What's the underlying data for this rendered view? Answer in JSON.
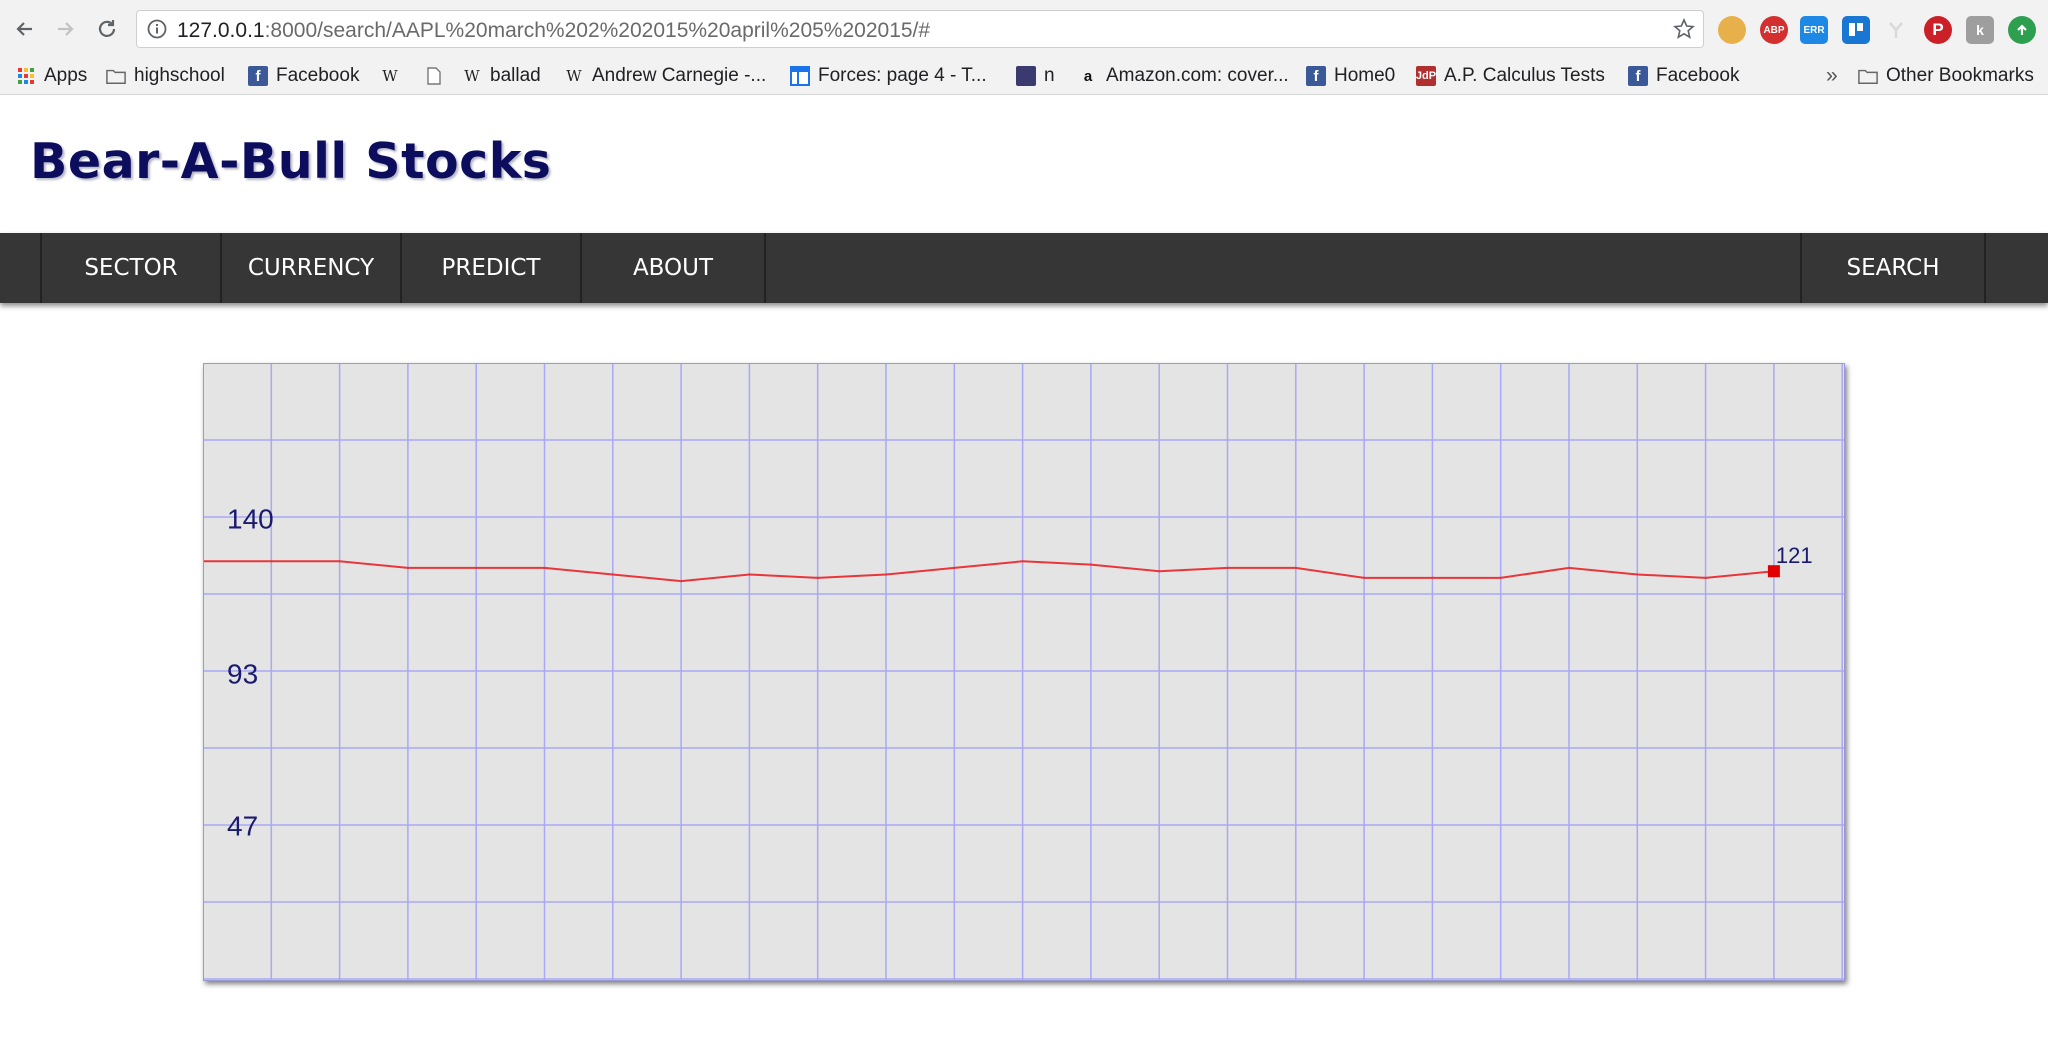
{
  "browser": {
    "url_host": "127.0.0.1",
    "url_rest": ":8000/search/AAPL%20march%202%202015%20april%205%202015/#",
    "bookmarks": [
      {
        "label": "Apps",
        "icon": "apps-grid-icon"
      },
      {
        "label": "highschool",
        "icon": "folder-icon"
      },
      {
        "label": "Facebook",
        "icon": "facebook-icon"
      },
      {
        "label": "",
        "icon": "wikipedia-icon"
      },
      {
        "label": "",
        "icon": "page-icon"
      },
      {
        "label": "ballad",
        "icon": "wikipedia-icon"
      },
      {
        "label": "Andrew Carnegie -...",
        "icon": "wikipedia-icon"
      },
      {
        "label": "Forces: page 4 - T...",
        "icon": "window-icon"
      },
      {
        "label": "n",
        "icon": "site-icon"
      },
      {
        "label": "Amazon.com: cover...",
        "icon": "amazon-icon"
      },
      {
        "label": "Home0",
        "icon": "facebook-icon"
      },
      {
        "label": "A.P. Calculus Tests",
        "icon": "site-icon"
      },
      {
        "label": "Facebook",
        "icon": "facebook-icon"
      }
    ],
    "overflow_label": "»",
    "other_bookmarks": "Other Bookmarks"
  },
  "site": {
    "title": "Bear-A-Bull Stocks"
  },
  "nav": {
    "items": [
      "SECTOR",
      "CURRENCY",
      "PREDICT",
      "ABOUT"
    ],
    "search": "SEARCH"
  },
  "chart_data": {
    "type": "line",
    "y_ticks": [
      "140",
      "93",
      "47"
    ],
    "ylim": [
      0,
      187
    ],
    "values": [
      127,
      127,
      127,
      125,
      125,
      125,
      123,
      121,
      123,
      122,
      123,
      125,
      127,
      126,
      124,
      125,
      125,
      122,
      122,
      122,
      125,
      123,
      122,
      124
    ],
    "last_label": "121",
    "series_color": "#e8363a",
    "grid_color": "#a8a8f5",
    "background": "#e4e4e4"
  }
}
